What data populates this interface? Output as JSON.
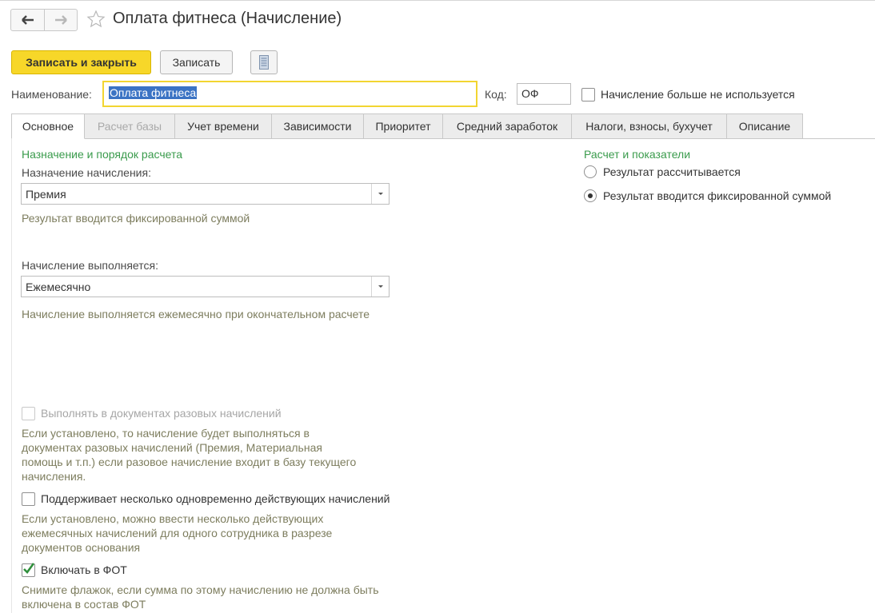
{
  "window": {
    "title": "Оплата фитнеса (Начисление)"
  },
  "toolbar": {
    "save_close_label": "Записать и закрыть",
    "save_label": "Записать"
  },
  "header": {
    "name_label": "Наименование:",
    "name_value": "Оплата фитнеса",
    "code_label": "Код:",
    "code_value": "ОФ",
    "not_used_label": "Начисление больше не используется"
  },
  "tabs": [
    {
      "label": "Основное",
      "active": true
    },
    {
      "label": "Расчет базы",
      "disabled": true
    },
    {
      "label": "Учет времени"
    },
    {
      "label": "Зависимости"
    },
    {
      "label": "Приоритет"
    },
    {
      "label": "Средний заработок"
    },
    {
      "label": "Налоги, взносы, бухучет"
    },
    {
      "label": "Описание"
    }
  ],
  "main": {
    "section_title": "Назначение и порядок расчета",
    "purpose_label": "Назначение начисления:",
    "purpose_value": "Премия",
    "purpose_hint": "Результат вводится фиксированной суммой",
    "execution_label": "Начисление выполняется:",
    "execution_value": "Ежемесячно",
    "execution_hint": "Начисление выполняется ежемесячно при окончательном расчете",
    "one_time_label": "Выполнять в документах разовых начислений",
    "one_time_hint": "Если установлено, то начисление будет выполняться в документах разовых начислений (Премия, Материальная помощь и т.п.) если разовое начисление входит в базу текущего начисления.",
    "multiple_label": "Поддерживает несколько одновременно действующих начислений",
    "multiple_hint": "Если установлено, можно ввести несколько действующих ежемесячных начислений для одного сотрудника в разрезе документов основания",
    "fot_label": "Включать в ФОТ",
    "fot_hint": "Снимите флажок, если сумма по этому начислению не должна быть включена в состав ФОТ"
  },
  "right": {
    "section_title": "Расчет и показатели",
    "radio_calculated": "Результат рассчитывается",
    "radio_fixed": "Результат вводится фиксированной суммой"
  },
  "colors": {
    "accent_yellow": "#f7d729",
    "section_green": "#3a9b4c",
    "hint_olive": "#7d7d5e",
    "selection_blue": "#3b73c4"
  },
  "icons": {
    "back": "arrow-left-icon",
    "forward": "arrow-right-icon",
    "favorite": "star-icon",
    "document": "document-icon",
    "dropdown": "chevron-down-icon",
    "checkmark": "check-icon"
  }
}
